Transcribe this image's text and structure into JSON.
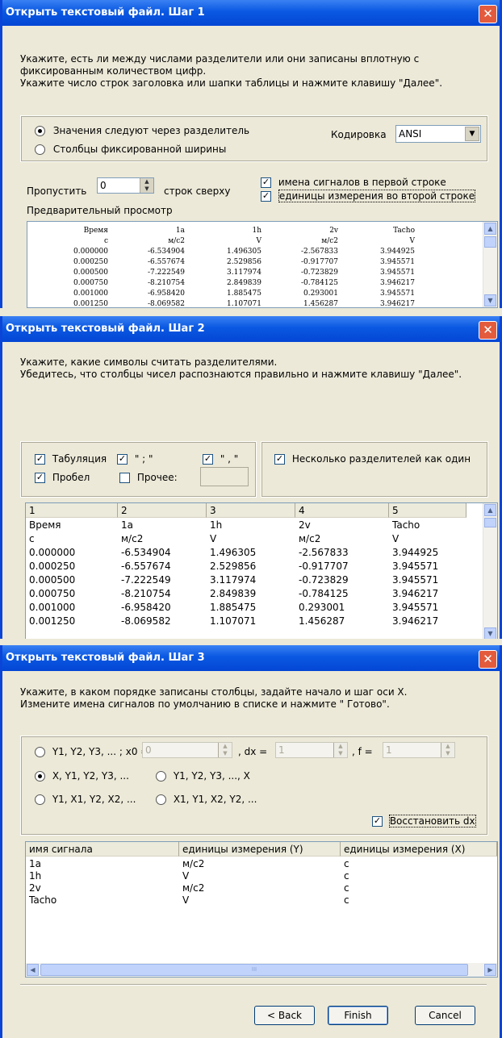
{
  "step1": {
    "title": "Открыть текстовый файл. Шаг 1",
    "close": "✕",
    "instructions": [
      "Укажите, есть ли между числами разделители или они записаны вплотную с",
      "фиксированным количеством цифр.",
      "Укажите число строк заголовка или шапки таблицы и нажмите клавишу \"Далее\"."
    ],
    "radio_delim": "Значения  следуют через разделитель",
    "radio_fixed": "Столбцы фиксированной ширины",
    "encoding_label": "Кодировка",
    "encoding_value": "ANSI",
    "skip_label": "Пропустить",
    "skip_value": "0",
    "skip_suffix": "строк сверху",
    "chk_names": "имена сигналов в первой строке",
    "chk_units": "единицы измерения во второй строке",
    "preview_label": "Предварительный просмотр",
    "preview_rows": [
      [
        "Время",
        "1a",
        "1h",
        "2v",
        "Tacho"
      ],
      [
        "c",
        "м/c2",
        "V",
        "м/c2",
        "V"
      ],
      [
        "0.000000",
        "-6.534904",
        "1.496305",
        "-2.567833",
        "3.944925"
      ],
      [
        "0.000250",
        "-6.557674",
        "2.529856",
        "-0.917707",
        "3.945571"
      ],
      [
        "0.000500",
        "-7.222549",
        "3.117974",
        "-0.723829",
        "3.945571"
      ],
      [
        "0.000750",
        "-8.210754",
        "2.849839",
        "-0.784125",
        "3.946217"
      ],
      [
        "0.001000",
        "-6.958420",
        "1.885475",
        "0.293001",
        "3.945571"
      ],
      [
        "0.001250",
        "-8.069582",
        "1.107071",
        "1.456287",
        "3.946217"
      ]
    ]
  },
  "step2": {
    "title": "Открыть текстовый файл. Шаг 2",
    "close": "✕",
    "instructions": [
      "Укажите, какие символы считать разделителями.",
      "Убедитесь, что столбцы чисел распознаются правильно и нажмите клавишу \"Далее\"."
    ],
    "chk_tab": "Табуляция",
    "chk_semicolon": "\" ; \"",
    "chk_comma": "\" , \"",
    "chk_space": "Пробел",
    "chk_other": "Прочее:",
    "chk_multi": "Несколько разделителей как один",
    "grid_headers": [
      "1",
      "2",
      "3",
      "4",
      "5"
    ],
    "grid_rows": [
      [
        "Время",
        "1a",
        "1h",
        "2v",
        "Tacho"
      ],
      [
        "c",
        "м/c2",
        "V",
        "м/c2",
        "V"
      ],
      [
        "0.000000",
        "-6.534904",
        "1.496305",
        "-2.567833",
        "3.944925"
      ],
      [
        "0.000250",
        "-6.557674",
        "2.529856",
        "-0.917707",
        "3.945571"
      ],
      [
        "0.000500",
        "-7.222549",
        "3.117974",
        "-0.723829",
        "3.945571"
      ],
      [
        "0.000750",
        "-8.210754",
        "2.849839",
        "-0.784125",
        "3.946217"
      ],
      [
        "0.001000",
        "-6.958420",
        "1.885475",
        "0.293001",
        "3.945571"
      ],
      [
        "0.001250",
        "-8.069582",
        "1.107071",
        "1.456287",
        "3.946217"
      ]
    ]
  },
  "step3": {
    "title": "Открыть текстовый файл. Шаг 3",
    "close": "✕",
    "instructions": [
      "Укажите, в каком порядке записаны столбцы, задайте начало и шаг оси X.",
      "Измените имена сигналов по умолчанию в списке и нажмите \" Готово\"."
    ],
    "opt_y_only": "Y1, Y2, Y3, ... ;  x0 =",
    "x0_value": "0",
    "dx_label": ", dx =",
    "dx_value": "1",
    "f_label": ", f =",
    "f_value": "1",
    "opt_x_y": "X, Y1, Y2, Y3, ...",
    "opt_y_x": "Y1, Y2, Y3, ..., X",
    "opt_yx_pairs": "Y1, X1,  Y2, X2, ...",
    "opt_xy_pairs": "X1, Y1,  X2, Y2, ...",
    "chk_restore": "Восстановить dx",
    "list_headers": [
      "имя сигнала",
      "единицы измерения (Y)",
      "единицы измерения (X)"
    ],
    "list_rows": [
      [
        "1a",
        "м/c2",
        "c"
      ],
      [
        "1h",
        "V",
        "c"
      ],
      [
        "2v",
        "м/c2",
        "c"
      ],
      [
        "Tacho",
        "V",
        "c"
      ]
    ],
    "scroll_mark": "III",
    "btn_back": "< Back",
    "btn_finish": "Finish",
    "btn_cancel": "Cancel"
  }
}
